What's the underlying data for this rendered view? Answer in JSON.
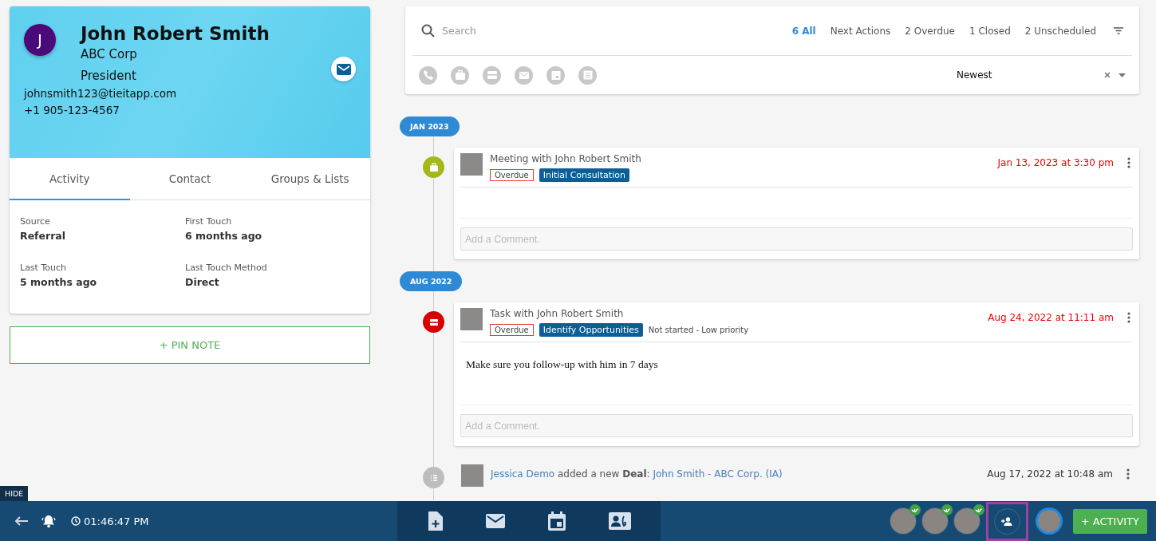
{
  "contact": {
    "initial": "J",
    "name": "John Robert Smith",
    "company": "ABC Corp",
    "title": "President",
    "email": "johnsmith123@tieitapp.com",
    "phone": "+1 905-123-4567"
  },
  "tabs": [
    {
      "label": "Activity",
      "selected": true
    },
    {
      "label": "Contact",
      "selected": false
    },
    {
      "label": "Groups & Lists",
      "selected": false
    }
  ],
  "details": [
    {
      "label": "Source",
      "value": "Referral"
    },
    {
      "label": "First Touch",
      "value": "6 months ago"
    },
    {
      "label": "Last Touch",
      "value": "5 months ago"
    },
    {
      "label": "Last Touch Method",
      "value": "Direct"
    }
  ],
  "pin_note": {
    "label": "+ PIN NOTE"
  },
  "search": {
    "placeholder": "Search"
  },
  "filters": [
    {
      "label": "6 All",
      "selected": true
    },
    {
      "label": "Next Actions",
      "selected": false
    },
    {
      "label": "2 Overdue",
      "selected": false
    },
    {
      "label": "1 Closed",
      "selected": false
    },
    {
      "label": "2 Unscheduled",
      "selected": false
    }
  ],
  "type_filters": [
    {
      "kind": "call"
    },
    {
      "kind": "meeting"
    },
    {
      "kind": "task"
    },
    {
      "kind": "email"
    },
    {
      "kind": "event"
    },
    {
      "kind": "deal"
    }
  ],
  "sort": {
    "value": "Newest"
  },
  "timeline": [
    {
      "kind": "month",
      "label": "JAN 2023"
    },
    {
      "kind": "meeting",
      "color": "#a4b81c",
      "title": "Meeting with John Robert Smith",
      "status": "Overdue",
      "tag": "Initial Consultation",
      "date": "Jan 13, 2023 at 3:30 pm",
      "comment_placeholder": "Add a Comment."
    },
    {
      "kind": "month",
      "label": "AUG 2022"
    },
    {
      "kind": "task",
      "color": "#d50000",
      "title": "Task with John Robert Smith",
      "status": "Overdue",
      "tag": "Identify Opportunities",
      "note": "Not started - Low priority",
      "body": "Make sure you follow-up with him in 7 days",
      "date": "Aug 24, 2022 at 11:11 am",
      "comment_placeholder": "Add a Comment."
    },
    {
      "kind": "deal",
      "color": "#bdbdbd",
      "actor": "Jessica Demo",
      "text": "added a new **Deal**:",
      "link": "John Smith - ABC Corp. (IA)",
      "date": "Aug 17, 2022 at 10:48 am"
    }
  ],
  "bottom_bar": {
    "hide": "HIDE",
    "clock": "01:46:47 PM",
    "users": [
      {
        "online": true
      },
      {
        "online": true
      },
      {
        "online": true
      }
    ],
    "add_user": {
      "highlighted": true
    },
    "activity_button": "+ ACTIVITY"
  }
}
